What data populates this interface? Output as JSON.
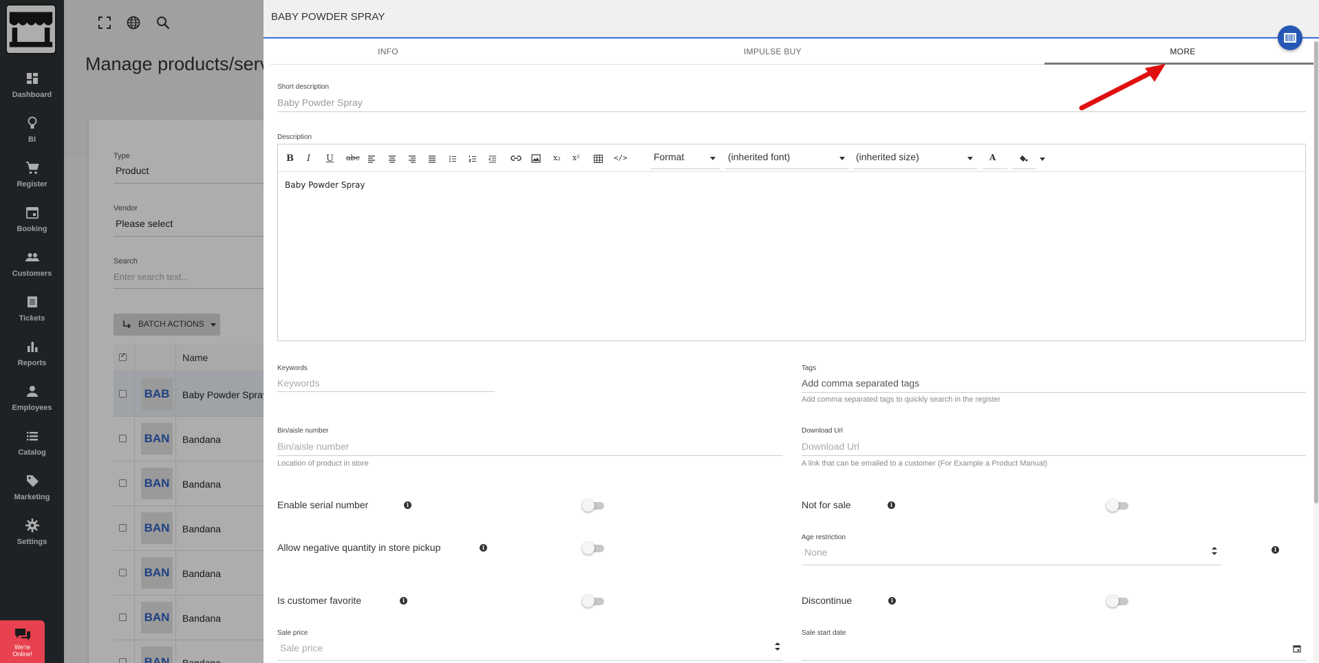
{
  "sidebar": {
    "items": [
      {
        "label": "Dashboard",
        "icon": "dashboard-icon"
      },
      {
        "label": "BI",
        "icon": "lightbulb-icon"
      },
      {
        "label": "Register",
        "icon": "cart-icon"
      },
      {
        "label": "Booking",
        "icon": "calendar-icon"
      },
      {
        "label": "Customers",
        "icon": "people-icon"
      },
      {
        "label": "Tickets",
        "icon": "ticket-icon"
      },
      {
        "label": "Reports",
        "icon": "bar-chart-icon"
      },
      {
        "label": "Employees",
        "icon": "person-icon"
      },
      {
        "label": "Catalog",
        "icon": "list-icon"
      },
      {
        "label": "Marketing",
        "icon": "tag-icon"
      },
      {
        "label": "Settings",
        "icon": "gear-icon"
      }
    ],
    "chat_label_1": "We're",
    "chat_label_2": "Online!"
  },
  "background": {
    "page_title": "Manage products/serv",
    "type_label": "Type",
    "type_value": "Product",
    "vendor_label": "Vendor",
    "vendor_value": "Please select",
    "search_label": "Search",
    "search_placeholder": "Enter search text...",
    "batch_actions": "BATCH ACTIONS",
    "name_header": "Name",
    "rows": [
      {
        "thumb": "BAB",
        "name": "Baby Powder Spray"
      },
      {
        "thumb": "BAN",
        "name": "Bandana"
      },
      {
        "thumb": "BAN",
        "name": "Bandana"
      },
      {
        "thumb": "BAN",
        "name": "Bandana"
      },
      {
        "thumb": "BAN",
        "name": "Bandana"
      },
      {
        "thumb": "BAN",
        "name": "Bandana"
      },
      {
        "thumb": "BAN",
        "name": "Bandana"
      }
    ]
  },
  "dialog": {
    "title": "BABY POWDER SPRAY",
    "tabs": [
      "INFO",
      "IMPULSE BUY",
      "MORE"
    ],
    "active_tab": "MORE",
    "short_description_label": "Short description",
    "short_description_value": "Baby Powder Spray",
    "description_label": "Description",
    "editor": {
      "format": "Format",
      "font": "(inherited font)",
      "size": "(inherited size)",
      "content": "Baby Powder Spray"
    },
    "keywords_label": "Keywords",
    "keywords_placeholder": "Keywords",
    "tags_label": "Tags",
    "tags_placeholder": "Add comma separated tags",
    "tags_hint": "Add comma separated tags to quickly search in the register",
    "bin_label": "Bin/aisle number",
    "bin_placeholder": "Bin/aisle number",
    "bin_hint": "Location of product in store",
    "download_label": "Download Url",
    "download_placeholder": "Download Url",
    "download_hint": "A link that can be emailed to a customer (For Example a Product Manual)",
    "enable_serial": "Enable serial number",
    "not_for_sale": "Not for sale",
    "allow_negative": "Allow negative quantity in store pickup",
    "age_restriction_label": "Age restriction",
    "age_restriction_value": "None",
    "is_customer_favorite": "Is customer favorite",
    "discontinue": "Discontinue",
    "sale_price_label": "Sale price",
    "sale_price_placeholder": "Sale price",
    "sale_start_label": "Sale start date"
  },
  "colors": {
    "sidebar_bg": "#2f3337",
    "accent_blue": "#3a6fd8",
    "barcode_btn": "#2457b4",
    "chat_red": "#e8414f",
    "annotation_arrow": "#e01010"
  }
}
